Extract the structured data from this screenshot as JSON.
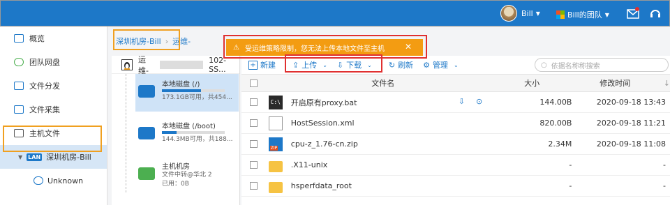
{
  "header": {
    "user_name": "Bill",
    "team_name": "Bill的团队",
    "colors": {
      "bar": "#1d78c8"
    }
  },
  "sidebar": {
    "items": [
      {
        "label": "概览",
        "icon": "overview-icon"
      },
      {
        "label": "团队网盘",
        "icon": "cloud-icon"
      },
      {
        "label": "文件分发",
        "icon": "distribute-icon"
      },
      {
        "label": "文件采集",
        "icon": "collect-icon"
      },
      {
        "label": "主机文件",
        "icon": "host-file-icon"
      }
    ],
    "host_group": {
      "badge": "LAN",
      "label": "深圳机房-Bill"
    },
    "host_item": {
      "label": "Unknown"
    }
  },
  "breadcrumb": {
    "root": "深圳机房-Bill",
    "host": "运维-"
  },
  "warning": {
    "text": "受运维策略限制，您无法上传本地文件至主机",
    "close": "✕"
  },
  "host_panel": {
    "host_label": "运维-",
    "host_suffix": "102-SS...",
    "disks": [
      {
        "name": "本地磁盘 (/)",
        "info": "173.1GB可用，共454...",
        "used": 0.62
      },
      {
        "name": "本地磁盘 (/boot)",
        "info": "144.3MB可用，共188...",
        "used": 0.23
      }
    ],
    "host_node": {
      "name": "主机机房",
      "line1": "文件中转@华北 2",
      "line2": "已用：0B"
    }
  },
  "toolbar": {
    "new": "新建",
    "upload": "上传",
    "download": "下载",
    "refresh": "刷新",
    "manage": "管理",
    "search_placeholder": "依据名称称搜索"
  },
  "table": {
    "headers": {
      "name": "文件名",
      "size": "大小",
      "time": "修改时间"
    },
    "rows": [
      {
        "name": "开启原有proxy.bat",
        "size": "144.00B",
        "time": "2020-09-18 13:43",
        "type": "bat"
      },
      {
        "name": "HostSession.xml",
        "size": "820.00B",
        "time": "2020-09-18 11:21",
        "type": "doc"
      },
      {
        "name": "cpu-z_1.76-cn.zip",
        "size": "2.34M",
        "time": "2020-09-18 11:08",
        "type": "zip"
      },
      {
        "name": ".X11-unix",
        "size": "-",
        "time": "-",
        "type": "folder"
      },
      {
        "name": "hsperfdata_root",
        "size": "-",
        "time": "-",
        "type": "folder"
      }
    ]
  }
}
